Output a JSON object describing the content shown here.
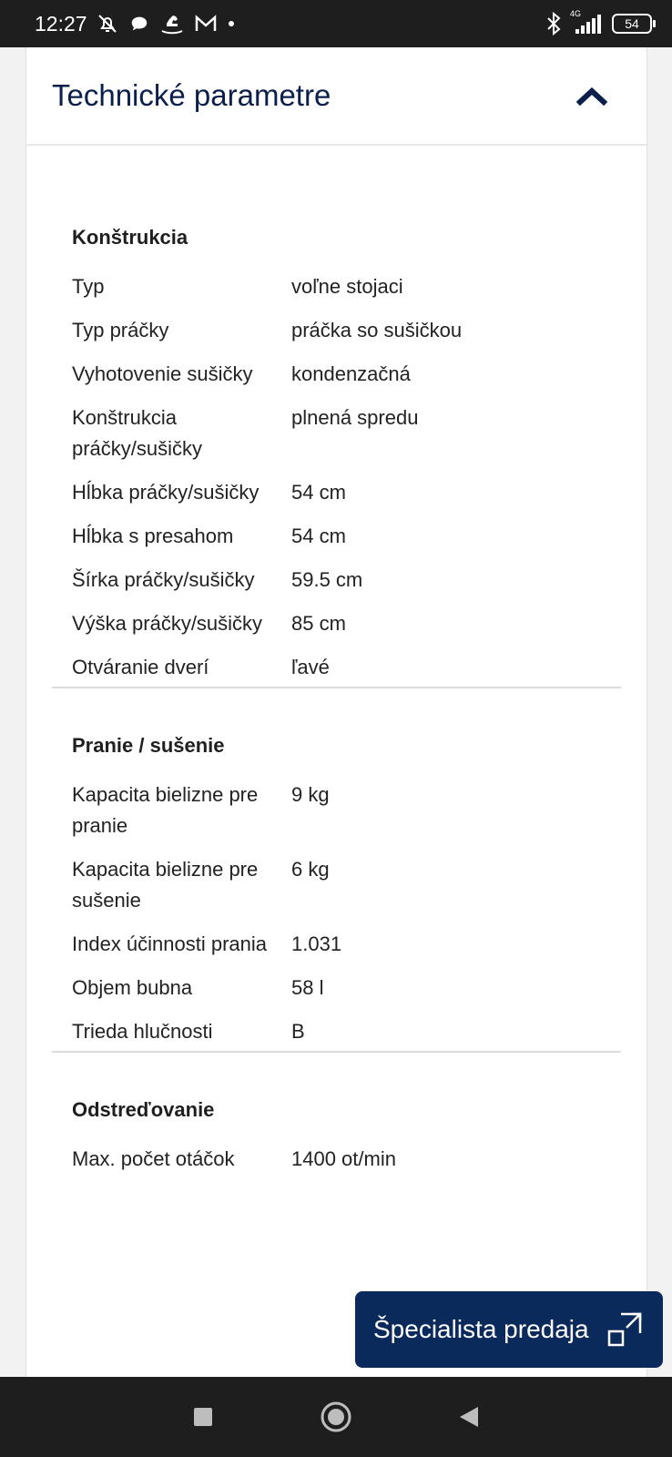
{
  "status_bar": {
    "time": "12:27",
    "network": "4G",
    "battery": "54",
    "icons": [
      "bell-off-icon",
      "chat-icon",
      "rocking-horse-icon",
      "gmail-icon",
      "dot-icon",
      "bluetooth-icon",
      "signal-icon",
      "battery-icon"
    ]
  },
  "card": {
    "title": "Technické parametre",
    "collapse_icon": "chevron-up-icon"
  },
  "sections": [
    {
      "title": "Konštrukcia",
      "rows": [
        {
          "label": "Typ",
          "value": "voľne stojaci"
        },
        {
          "label": "Typ práčky",
          "value": "práčka so sušičkou"
        },
        {
          "label": "Vyhotovenie sušičky",
          "value": "kondenzačná"
        },
        {
          "label": "Konštrukcia práčky/sušičky",
          "value": "plnená spredu"
        },
        {
          "label": "Hĺbka práčky/sušičky",
          "value": "54 cm"
        },
        {
          "label": "Hĺbka s presahom",
          "value": "54 cm"
        },
        {
          "label": "Šírka práčky/sušičky",
          "value": "59.5 cm"
        },
        {
          "label": "Výška práčky/sušičky",
          "value": "85 cm"
        },
        {
          "label": "Otváranie dverí",
          "value": "ľavé"
        }
      ]
    },
    {
      "title": "Pranie / sušenie",
      "rows": [
        {
          "label": "Kapacita bielizne pre pranie",
          "value": "9 kg"
        },
        {
          "label": "Kapacita bielizne pre sušenie",
          "value": "6 kg"
        },
        {
          "label": "Index účinnosti prania",
          "value": "1.031"
        },
        {
          "label": "Objem bubna",
          "value": "58 l"
        },
        {
          "label": "Trieda hlučnosti",
          "value": "B"
        }
      ]
    },
    {
      "title": "Odstreďovanie",
      "rows": [
        {
          "label": "Max. počet otáčok",
          "value": "1400 ot/min"
        }
      ]
    }
  ],
  "fab": {
    "label": "Špecialista predaja",
    "icon": "expand-icon"
  },
  "nav_bar": {
    "icons": [
      "recent-apps-icon",
      "home-icon",
      "back-icon"
    ]
  },
  "colors": {
    "heading": "#0b1f4d",
    "fab_background": "#0b2a5c",
    "system_bars": "#1e1e1e"
  }
}
